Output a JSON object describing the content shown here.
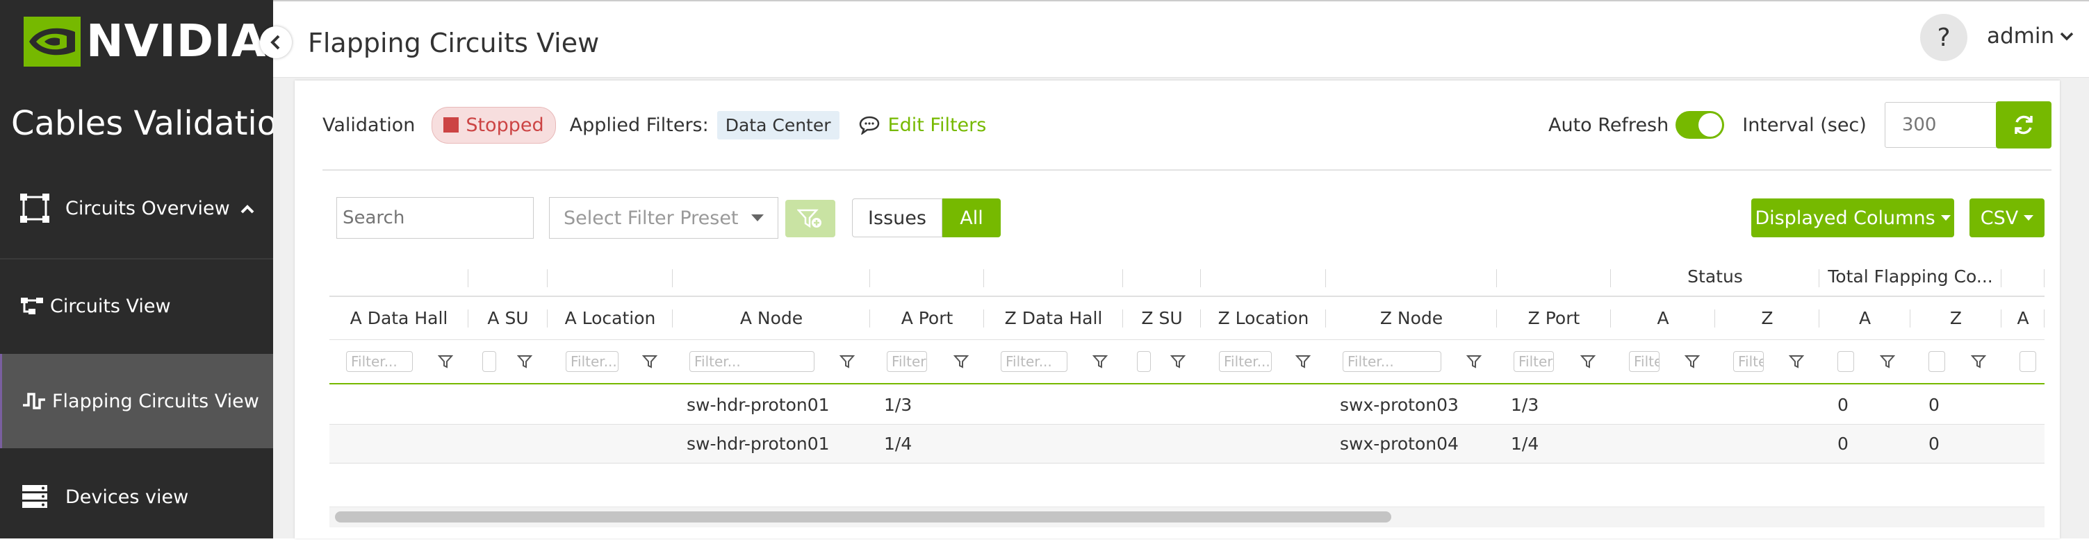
{
  "brand": {
    "logo_text": "NVIDIA",
    "accent": "#76b900"
  },
  "sidebar": {
    "app_title": "Cables Validation",
    "section": {
      "label": "Circuits Overview",
      "icon": "circuits-overview-icon"
    },
    "items": [
      {
        "label": "Circuits View",
        "icon": "circuits-view-icon"
      },
      {
        "label": "Flapping Circuits View",
        "icon": "flapping-icon",
        "active": true
      },
      {
        "label": "Devices view",
        "icon": "devices-icon"
      }
    ]
  },
  "header": {
    "title": "Flapping Circuits View",
    "help": "?",
    "user": "admin"
  },
  "toolbar": {
    "validation_label": "Validation",
    "status": "Stopped",
    "applied_filters_label": "Applied Filters:",
    "filter_chip": "Data Center",
    "edit_filters": "Edit Filters",
    "auto_refresh_label": "Auto Refresh",
    "auto_refresh_on": true,
    "interval_label": "Interval (sec)",
    "interval_placeholder": "300"
  },
  "controls": {
    "search_placeholder": "Search",
    "preset_placeholder": "Select Filter Preset",
    "issues": "Issues",
    "all": "All",
    "displayed_columns": "Displayed Columns",
    "csv": "CSV"
  },
  "table": {
    "group_headers": {
      "status": "Status",
      "flapping": "Total Flapping Co..."
    },
    "columns": [
      "A Data Hall",
      "A SU",
      "A Location",
      "A Node",
      "A Port",
      "Z Data Hall",
      "Z SU",
      "Z Location",
      "Z Node",
      "Z Port",
      "A",
      "Z",
      "A",
      "Z",
      "A"
    ],
    "filter_placeholder": "Filter...",
    "rows": [
      {
        "a_data_hall": "",
        "a_su": "",
        "a_location": "",
        "a_node": "sw-hdr-proton01",
        "a_port": "1/3",
        "z_data_hall": "",
        "z_su": "",
        "z_location": "",
        "z_node": "swx-proton03",
        "z_port": "1/3",
        "status_a": "",
        "status_z": "",
        "flap_a": "0",
        "flap_z": "0"
      },
      {
        "a_data_hall": "",
        "a_su": "",
        "a_location": "",
        "a_node": "sw-hdr-proton01",
        "a_port": "1/4",
        "z_data_hall": "",
        "z_su": "",
        "z_location": "",
        "z_node": "swx-proton04",
        "z_port": "1/4",
        "status_a": "",
        "status_z": "",
        "flap_a": "0",
        "flap_z": "0"
      }
    ]
  }
}
